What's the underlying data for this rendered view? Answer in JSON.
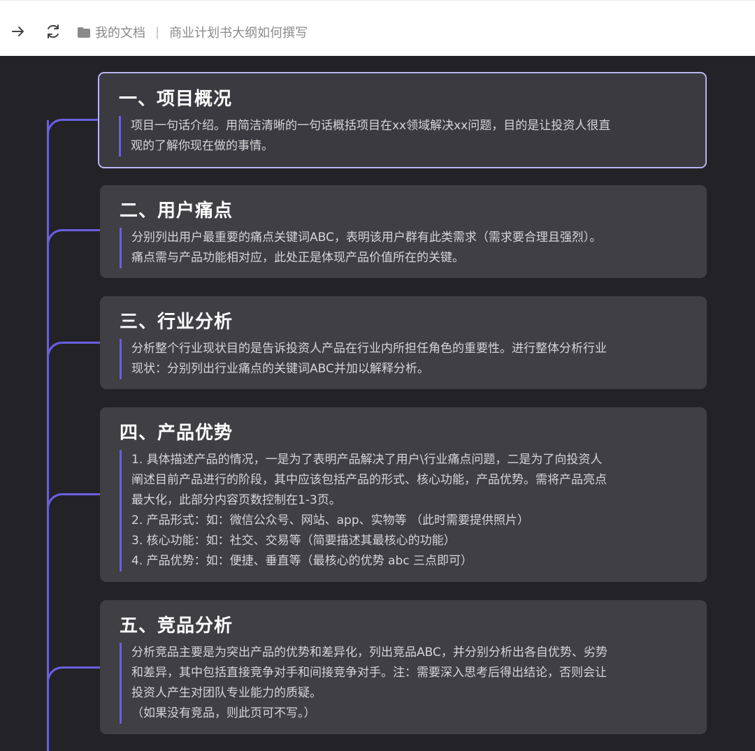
{
  "toolbar": {
    "forward_icon": "arrow-right-icon",
    "refresh_icon": "refresh-icon",
    "folder_icon": "folder-icon"
  },
  "breadcrumb": {
    "root": "我的文档",
    "separator": "|",
    "current": "商业计划书大纲如何撰写"
  },
  "colors": {
    "canvas_bg": "#232327",
    "card_bg": "#3f3f44",
    "connector": "#6a5fe0",
    "selected_border": "#b9b3f2"
  },
  "sections": [
    {
      "title": "一、项目概况",
      "lines": [
        "项目一句话介绍。用简洁清晰的一句话概括项目在xx领域解决xx问题，目的是让投资人很直",
        "观的了解你现在做的事情。"
      ]
    },
    {
      "title": "二、用户痛点",
      "lines": [
        "分别列出用户最重要的痛点关键词ABC，表明该用户群有此类需求（需求要合理且强烈）。",
        "痛点需与产品功能相对应，此处正是体现产品价值所在的关键。"
      ]
    },
    {
      "title": "三、行业分析",
      "lines": [
        "分析整个行业现状目的是告诉投资人产品在行业内所担任角色的重要性。进行整体分析行业",
        "现状：分别列出行业痛点的关键词ABC并加以解释分析。"
      ]
    },
    {
      "title": "四、产品优势",
      "lines": [
        "1. 具体描述产品的情况，一是为了表明产品解决了用户\\行业痛点问题，二是为了向投资人",
        "阐述目前产品进行的阶段，其中应该包括产品的形式、核心功能，产品优势。需将产品亮点",
        "最大化，此部分内容页数控制在1-3页。",
        "2. 产品形式：如：微信公众号、网站、app、实物等 （此时需要提供照片）",
        "3. 核心功能：如：社交、交易等（简要描述其最核心的功能）",
        "4. 产品优势：如：便捷、垂直等（最核心的优势 abc 三点即可）"
      ]
    },
    {
      "title": "五、竞品分析",
      "lines": [
        "分析竞品主要是为突出产品的优势和差异化，列出竞品ABC，并分别分析出各自优势、劣势",
        "和差异，其中包括直接竞争对手和间接竞争对手。注：需要深入思考后得出结论，否则会让",
        "投资人产生对团队专业能力的质疑。",
        "（如果没有竞品，则此页可不写。）"
      ]
    }
  ]
}
